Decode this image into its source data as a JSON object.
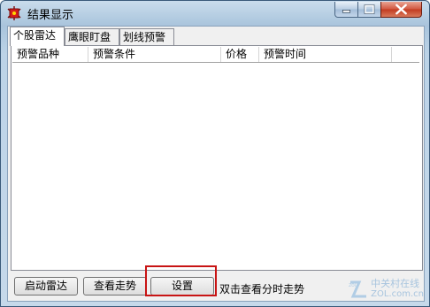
{
  "window": {
    "title": "结果显示",
    "colors": {
      "accent": "#c81414",
      "title_bar": "#a9c4dc"
    }
  },
  "tabs": [
    {
      "label": "个股雷达",
      "active": true
    },
    {
      "label": "鹰眼盯盘",
      "active": false
    },
    {
      "label": "划线预警",
      "active": false
    }
  ],
  "list": {
    "columns": [
      "预警品种",
      "预警条件",
      "价格",
      "预警时间"
    ],
    "rows": []
  },
  "buttons": {
    "start": "启动雷达",
    "view_trend": "查看走势",
    "settings": "设置"
  },
  "hint": "双击查看分时走势",
  "watermark": {
    "logo": "zol",
    "text": "中关村在线",
    "site": "ZOL.com.cn"
  }
}
